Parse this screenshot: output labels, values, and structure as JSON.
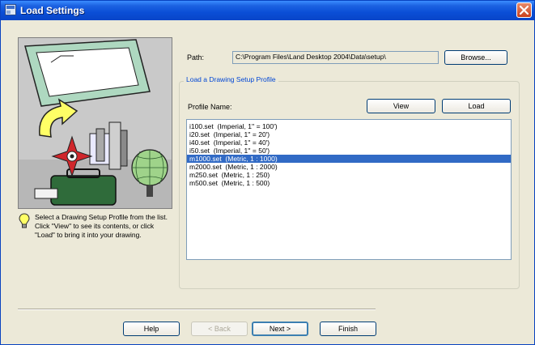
{
  "window": {
    "title": "Load Settings"
  },
  "path": {
    "label": "Path:",
    "value": "C:\\Program Files\\Land Desktop 2004\\Data\\setup\\",
    "browse_label": "Browse..."
  },
  "group": {
    "title": "Load a Drawing Setup Profile",
    "profile_label": "Profile Name:",
    "view_label": "View",
    "load_label": "Load",
    "items": [
      "i100.set  (Imperial, 1'' = 100')",
      "i20.set  (Imperial, 1'' = 20')",
      "i40.set  (Imperial, 1'' = 40')",
      "i50.set  (Imperial, 1'' = 50')",
      "m1000.set  (Metric, 1 : 1000)",
      "m2000.set  (Metric, 1 : 2000)",
      "m250.set  (Metric, 1 : 250)",
      "m500.set  (Metric, 1 : 500)"
    ],
    "selected_index": 4
  },
  "tip": {
    "text": "Select a Drawing Setup Profile from the list.  Click \"View\" to see its contents, or click \"Load\" to bring it into your drawing."
  },
  "footer": {
    "help_label": "Help",
    "back_label": "< Back",
    "next_label": "Next >",
    "finish_label": "Finish"
  },
  "icons": {
    "title": "window-icon",
    "close": "close-icon",
    "tip": "lightbulb-icon"
  },
  "colors": {
    "titlebar": "#0a4ed6",
    "selection": "#316ac5",
    "dialog": "#ece9d8"
  }
}
